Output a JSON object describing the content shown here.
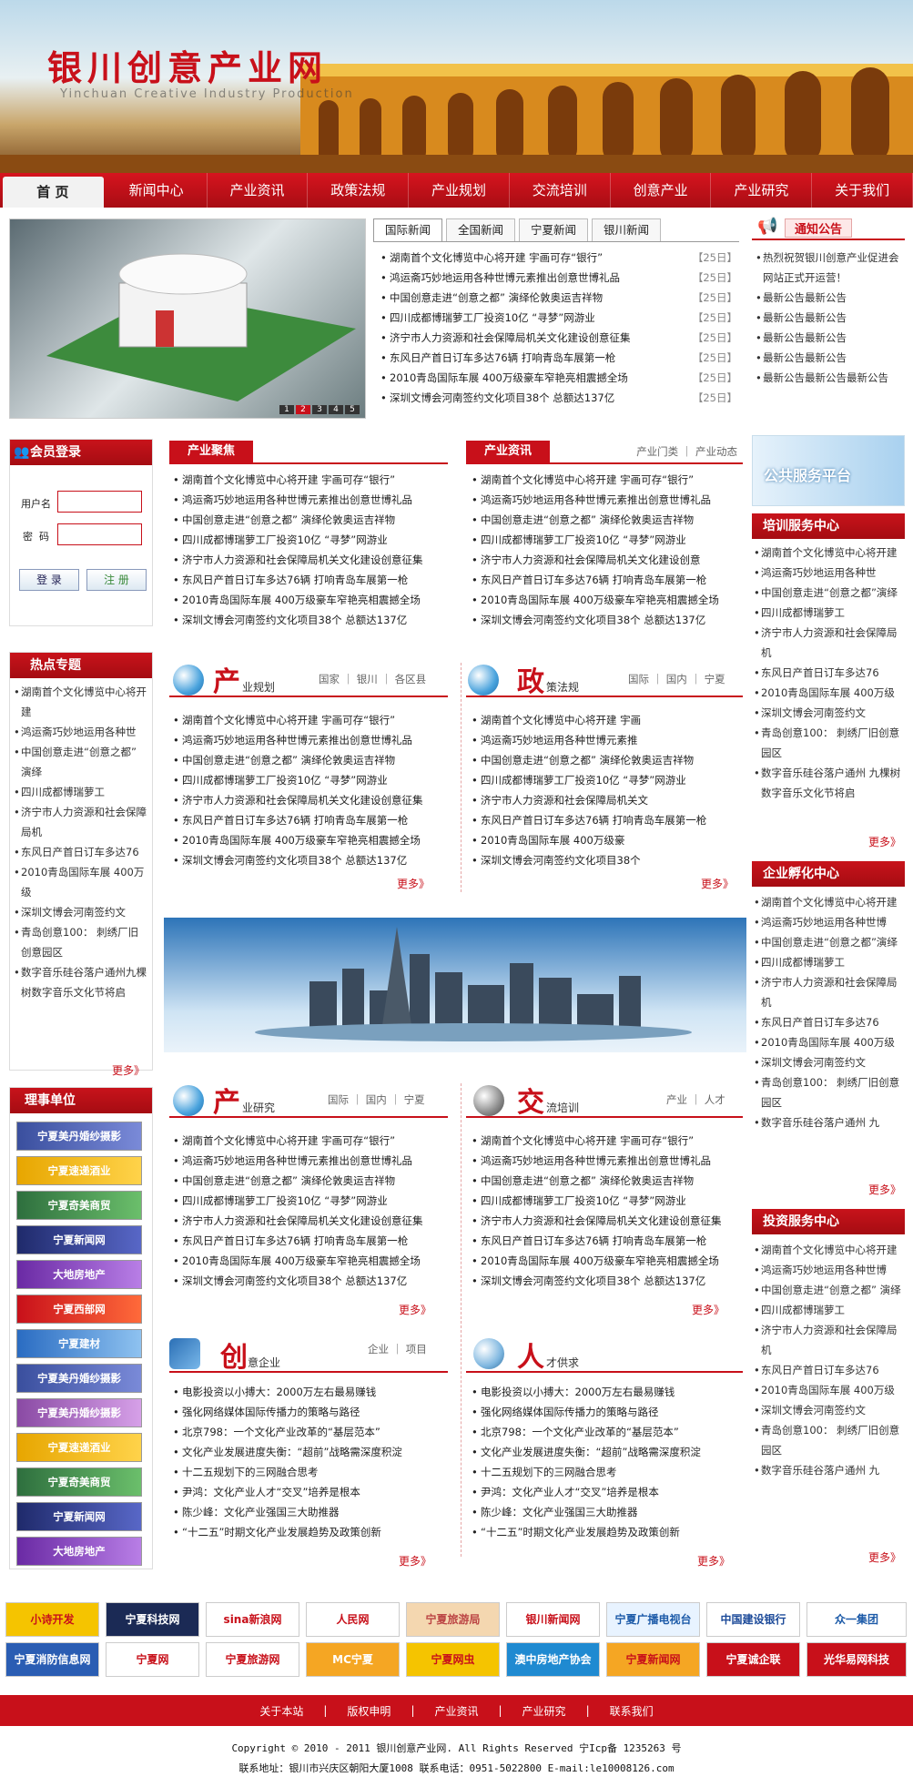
{
  "site": {
    "title": "银川创意产业网",
    "subtitle": "Yinchuan Creative Industry Production"
  },
  "nav": [
    "首 页",
    "新闻中心",
    "产业资讯",
    "政策法规",
    "产业规划",
    "交流培训",
    "创意产业",
    "产业研究",
    "关于我们"
  ],
  "slider": {
    "pages": [
      "1",
      "2",
      "3",
      "4",
      "5"
    ]
  },
  "newsTabs": [
    "国际新闻",
    "全国新闻",
    "宁夏新闻",
    "银川新闻"
  ],
  "topNews": [
    {
      "t": "湖南首个文化博览中心将开建 宇画可存“银行”",
      "d": "【25日】"
    },
    {
      "t": "鸿运斋巧妙地运用各种世博元素推出创意世博礼品",
      "d": "【25日】"
    },
    {
      "t": "中国创意走进“创意之都” 演绎伦敦奥运吉祥物",
      "d": "【25日】"
    },
    {
      "t": "四川成都博瑞萝工厂投资10亿 “寻梦”网游业",
      "d": "【25日】"
    },
    {
      "t": "济宁市人力资源和社会保障局机关文化建设创意征集",
      "d": "【25日】"
    },
    {
      "t": "东风日产首日订车多达76辆 打响青岛车展第一枪",
      "d": "【25日】"
    },
    {
      "t": "2010青岛国际车展 400万级豪车窄艳亮相震撼全场",
      "d": "【25日】"
    },
    {
      "t": "深圳文博会河南签约文化项目38个 总额达137亿",
      "d": "【25日】"
    }
  ],
  "notice": {
    "title": "通知公告",
    "items": [
      "热烈祝贺银川创意产业促进会网站正式开运营！",
      "最新公告最新公告",
      "最新公告最新公告",
      "最新公告最新公告",
      "最新公告最新公告",
      "最新公告最新公告最新公告"
    ]
  },
  "login": {
    "title": "会员登录",
    "user": "用户名",
    "pass": "密  码",
    "login": "登 录",
    "register": "注 册"
  },
  "industryFocus": {
    "title": "产业聚焦",
    "items": [
      "湖南首个文化博览中心将开建 宇画可存“银行”",
      "鸿运斋巧妙地运用各种世博元素推出创意世博礼品",
      "中国创意走进“创意之都” 演绎伦敦奥运吉祥物",
      "四川成都博瑞萝工厂投资10亿 “寻梦”网游业",
      "济宁市人力资源和社会保障局机关文化建设创意征集",
      "东风日产首日订车多达76辆 打响青岛车展第一枪",
      "2010青岛国际车展 400万级豪车窄艳亮相震撼全场",
      "深圳文博会河南签约文化项目38个 总额达137亿"
    ]
  },
  "industryNews": {
    "title": "产业资讯",
    "links": "产业门类 ｜ 产业动态",
    "items": [
      "湖南首个文化博览中心将开建 宇画可存“银行”",
      "鸿运斋巧妙地运用各种世博元素推出创意世博礼品",
      "中国创意走进“创意之都” 演绎伦敦奥运吉祥物",
      "四川成都博瑞萝工厂投资10亿 “寻梦”网游业",
      "济宁市人力资源和社会保障局机关文化建设创意",
      "东风日产首日订车多达76辆 打响青岛车展第一枪",
      "2010青岛国际车展 400万级豪车窄艳亮相震撼全场",
      "深圳文博会河南签约文化项目38个 总额达137亿"
    ]
  },
  "publicService": "公共服务平台",
  "training": {
    "title": "培训服务中心",
    "items": [
      "湖南首个文化博览中心将开建",
      "鸿运斋巧妙地运用各种世",
      "中国创意走进“创意之都”演绎",
      "四川成都博瑞萝工",
      "济宁市人力资源和社会保障局机",
      "东风日产首日订车多达76",
      "2010青岛国际车展 400万级",
      "深圳文博会河南签约文",
      "青岛创意100： 刺绣厂旧创意园区",
      "数字音乐硅谷落户通州 九棵树数字音乐文化节将启"
    ],
    "more": "更多》"
  },
  "hot": {
    "title": "热点专题",
    "items": [
      "湖南首个文化博览中心将开建",
      "鸿运斋巧妙地运用各种世",
      "中国创意走进“创意之都” 演绎",
      "四川成都博瑞萝工",
      "济宁市人力资源和社会保障局机",
      "东风日产首日订车多达76",
      "2010青岛国际车展 400万级",
      "深圳文博会河南签约文",
      "青岛创意100： 刺绣厂旧创意园区",
      "数字音乐硅谷落户通州九棵树数字音乐文化节将启"
    ],
    "more": "更多》"
  },
  "plan": {
    "big": "产",
    "rest": "业规划",
    "links": "国家 ｜ 银川 ｜ 各区县",
    "items": [
      "湖南首个文化博览中心将开建 宇画可存“银行”",
      "鸿运斋巧妙地运用各种世博元素推出创意世博礼品",
      "中国创意走进“创意之都” 演绎伦敦奥运吉祥物",
      "四川成都博瑞萝工厂投资10亿 “寻梦”网游业",
      "济宁市人力资源和社会保障局机关文化建设创意征集",
      "东风日产首日订车多达76辆 打响青岛车展第一枪",
      "2010青岛国际车展 400万级豪车窄艳亮相震撼全场",
      "深圳文博会河南签约文化项目38个 总额达137亿"
    ],
    "more": "更多》"
  },
  "policy": {
    "big": "政",
    "rest": "策法规",
    "links": "国际 ｜ 国内 ｜ 宁夏",
    "items": [
      "湖南首个文化博览中心将开建 宇画",
      "鸿运斋巧妙地运用各种世博元素推",
      "中国创意走进“创意之都” 演绎伦敦奥运吉祥物",
      "四川成都博瑞萝工厂投资10亿 “寻梦”网游业",
      "济宁市人力资源和社会保障局机关文",
      "东风日产首日订车多达76辆 打响青岛车展第一枪",
      "2010青岛国际车展 400万级豪",
      "深圳文博会河南签约文化项目38个"
    ],
    "more": "更多》"
  },
  "incubator": {
    "title": "企业孵化中心",
    "items": [
      "湖南首个文化博览中心将开建",
      "鸿运斋巧妙地运用各种世博",
      "中国创意走进“创意之都”演绎",
      "四川成都博瑞萝工",
      "济宁市人力资源和社会保障局机",
      "东风日产首日订车多达76",
      "2010青岛国际车展 400万级",
      "深圳文博会河南签约文",
      "青岛创意100： 刺绣厂旧创意园区",
      "数字音乐硅谷落户通州 九"
    ],
    "more": "更多》"
  },
  "research": {
    "big": "产",
    "rest": "业研究",
    "links": "国际 ｜ 国内 ｜ 宁夏",
    "items": [
      "湖南首个文化博览中心将开建 宇画可存“银行”",
      "鸿运斋巧妙地运用各种世博元素推出创意世博礼品",
      "中国创意走进“创意之都” 演绎伦敦奥运吉祥物",
      "四川成都博瑞萝工厂投资10亿 “寻梦”网游业",
      "济宁市人力资源和社会保障局机关文化建设创意征集",
      "东风日产首日订车多达76辆 打响青岛车展第一枪",
      "2010青岛国际车展 400万级豪车窄艳亮相震撼全场",
      "深圳文博会河南签约文化项目38个 总额达137亿"
    ],
    "more": "更多》"
  },
  "exchange": {
    "big": "交",
    "rest": "流培训",
    "links": "产业 ｜ 人才",
    "items": [
      "湖南首个文化博览中心将开建 宇画可存“银行”",
      "鸿运斋巧妙地运用各种世博元素推出创意世博礼品",
      "中国创意走进“创意之都” 演绎伦敦奥运吉祥物",
      "四川成都博瑞萝工厂投资10亿 “寻梦”网游业",
      "济宁市人力资源和社会保障局机关文化建设创意征集",
      "东风日产首日订车多达76辆 打响青岛车展第一枪",
      "2010青岛国际车展 400万级豪车窄艳亮相震撼全场",
      "深圳文博会河南签约文化项目38个 总额达137亿"
    ],
    "more": "更多》"
  },
  "creative": {
    "big": "创",
    "rest": "意企业",
    "links": "企业 ｜ 项目",
    "items": [
      "电影投资以小搏大：2000万左右最易赚钱",
      "强化网络媒体国际传播力的策略与路径",
      "北京798：一个文化产业改革的“基层范本”",
      "文化产业发展进度失衡：“超前”战略需深度积淀",
      "十二五规划下的三网融合思考",
      "尹鸿：文化产业人才“交叉”培养是根本",
      "陈少峰：文化产业强国三大助推器",
      "“十二五”时期文化产业发展趋势及政策创新"
    ],
    "more": "更多》"
  },
  "talent": {
    "big": "人",
    "rest": "才供求",
    "items": [
      "电影投资以小搏大：2000万左右最易赚钱",
      "强化网络媒体国际传播力的策略与路径",
      "北京798：一个文化产业改革的“基层范本”",
      "文化产业发展进度失衡：“超前”战略需深度积淀",
      "十二五规划下的三网融合思考",
      "尹鸿：文化产业人才“交叉”培养是根本",
      "陈少峰：文化产业强国三大助推器",
      "“十二五”时期文化产业发展趋势及政策创新"
    ],
    "more": "更多》"
  },
  "investment": {
    "title": "投资服务中心",
    "items": [
      "湖南首个文化博览中心将开建",
      "鸿运斋巧妙地运用各种世博",
      "中国创意走进“创意之都” 演绎",
      "四川成都博瑞萝工",
      "济宁市人力资源和社会保障局机",
      "东风日产首日订车多达76",
      "2010青岛国际车展 400万级",
      "深圳文博会河南签约文",
      "青岛创意100： 刺绣厂旧创意园区",
      "数字音乐硅谷落户通州 九"
    ],
    "more": "更多》"
  },
  "council": {
    "title": "理事单位",
    "items": [
      "宁夏美丹婚纱摄影",
      "宁夏速递酒业",
      "宁夏奇美商贸",
      "宁夏新闻网",
      "大地房地产",
      "宁夏西部网",
      "宁夏建材",
      "宁夏美丹婚纱摄影",
      "宁夏美丹婚纱摄影",
      "宁夏速递酒业",
      "宁夏奇美商贸",
      "宁夏新闻网",
      "大地房地产"
    ]
  },
  "links": [
    "小诗开发",
    "宁夏科技网",
    "sina新浪网",
    "人民网",
    "宁夏旅游局",
    "银川新闻网",
    "宁夏广播电视台",
    "中国建设银行",
    "众一集团",
    "宁夏消防信息网",
    "宁夏网",
    "宁夏旅游网",
    "MC宁夏",
    "宁夏网虫",
    "澳中房地产协会",
    "宁夏新闻网",
    "宁夏诚企联",
    "光华易网科技"
  ],
  "footer": {
    "links": [
      "关于本站",
      "版权申明",
      "产业资讯",
      "产业研究",
      "联系我们"
    ],
    "copyright": "Copyright © 2010 - 2011 银川创意产业网. All Rights Reserved  宁Icp备 1235263 号",
    "contact": "联系地址：银川市兴庆区朝阳大厦1008  联系电话：0951-5022800  E-mail:le10008126.com"
  }
}
